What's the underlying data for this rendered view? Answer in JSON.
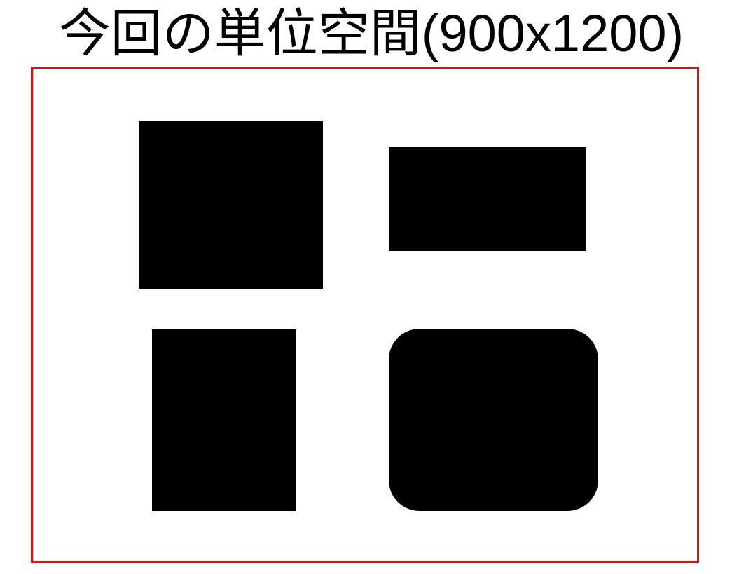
{
  "title": "今回の単位空間(900x1200)",
  "colors": {
    "frame_border": "#e01010",
    "shape_fill": "#000000",
    "background": "#ffffff"
  },
  "shapes": [
    {
      "name": "square",
      "corner": "sharp"
    },
    {
      "name": "wide-rectangle",
      "corner": "sharp"
    },
    {
      "name": "tall-rectangle",
      "corner": "sharp"
    },
    {
      "name": "rounded-rectangle",
      "corner": "rounded"
    }
  ]
}
